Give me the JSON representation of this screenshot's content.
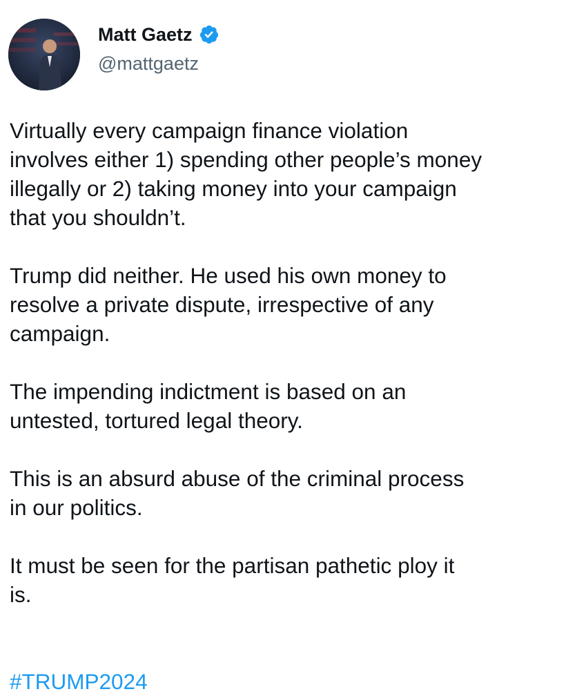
{
  "author": {
    "display_name": "Matt Gaetz",
    "handle": "@mattgaetz",
    "verified": true,
    "verified_color": "#1d9bf0"
  },
  "tweet": {
    "paragraphs": [
      "Virtually every campaign finance violation\ninvolves either 1) spending other people’s money\nillegally or 2) taking money into your campaign\nthat you shouldn’t.",
      "Trump did neither. He used his own money to\nresolve a private dispute, irrespective of any\ncampaign.",
      "The impending indictment is based on an\nuntested, tortured legal theory.",
      "This is an absurd abuse of the criminal process\nin our politics.",
      "It must be seen for the partisan pathetic ploy it\nis."
    ],
    "hashtag": "#TRUMP2024"
  },
  "colors": {
    "text": "#0f1419",
    "secondary_text": "#536471",
    "link": "#1d9bf0"
  }
}
